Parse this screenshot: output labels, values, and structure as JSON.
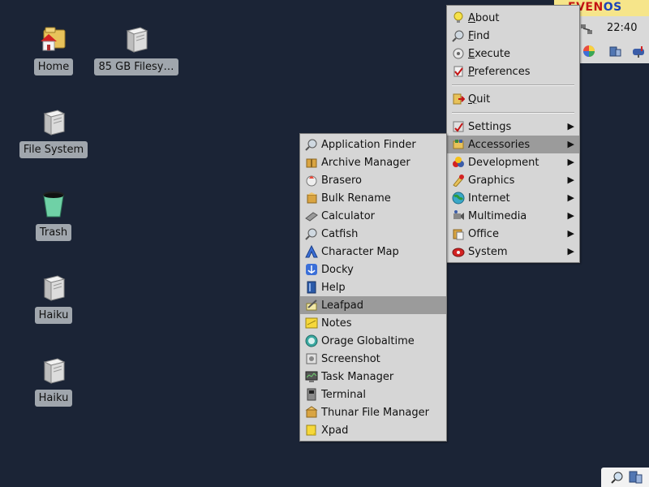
{
  "desktop": {
    "icons": [
      {
        "label": "Home",
        "icon": "home-folder-icon"
      },
      {
        "label": "85 GB Filesy…",
        "icon": "drive-icon"
      },
      {
        "label": "File System",
        "icon": "drive-icon"
      },
      {
        "label": "Trash",
        "icon": "trash-icon"
      },
      {
        "label": "Haiku",
        "icon": "drive-icon"
      },
      {
        "label": "Haiku",
        "icon": "drive-icon"
      }
    ]
  },
  "panel": {
    "brand_part1": "EVEN",
    "brand_part2": "OS",
    "clock": "22:40"
  },
  "main_menu": {
    "items": [
      {
        "label": "About",
        "icon": "lightbulb-icon",
        "underline": "A"
      },
      {
        "label": "Find",
        "icon": "find-icon",
        "underline": "F"
      },
      {
        "label": "Execute",
        "icon": "execute-icon",
        "underline": "E"
      },
      {
        "label": "Preferences",
        "icon": "preferences-icon",
        "underline": "P"
      },
      {
        "label": "Quit",
        "icon": "quit-icon",
        "underline": "Q"
      },
      {
        "label": "Settings",
        "icon": "settings-icon"
      },
      {
        "label": "Accessories",
        "icon": "accessories-icon"
      },
      {
        "label": "Development",
        "icon": "development-icon"
      },
      {
        "label": "Graphics",
        "icon": "graphics-icon"
      },
      {
        "label": "Internet",
        "icon": "internet-icon"
      },
      {
        "label": "Multimedia",
        "icon": "multimedia-icon"
      },
      {
        "label": "Office",
        "icon": "office-icon"
      },
      {
        "label": "System",
        "icon": "system-icon"
      }
    ]
  },
  "accessories_menu": {
    "items": [
      {
        "label": "Application Finder",
        "icon": "app-finder-icon"
      },
      {
        "label": "Archive Manager",
        "icon": "archive-icon"
      },
      {
        "label": "Brasero",
        "icon": "brasero-icon"
      },
      {
        "label": "Bulk Rename",
        "icon": "bulk-rename-icon"
      },
      {
        "label": "Calculator",
        "icon": "calculator-icon"
      },
      {
        "label": "Catfish",
        "icon": "catfish-icon"
      },
      {
        "label": "Character Map",
        "icon": "character-map-icon"
      },
      {
        "label": "Docky",
        "icon": "docky-icon"
      },
      {
        "label": "Help",
        "icon": "help-icon"
      },
      {
        "label": "Leafpad",
        "icon": "leafpad-icon"
      },
      {
        "label": "Notes",
        "icon": "notes-icon"
      },
      {
        "label": "Orage Globaltime",
        "icon": "globaltime-icon"
      },
      {
        "label": "Screenshot",
        "icon": "screenshot-icon"
      },
      {
        "label": "Task Manager",
        "icon": "task-manager-icon"
      },
      {
        "label": "Terminal",
        "icon": "terminal-icon"
      },
      {
        "label": "Thunar File Manager",
        "icon": "thunar-icon"
      },
      {
        "label": "Xpad",
        "icon": "xpad-icon"
      }
    ]
  },
  "colors": {
    "desktop_bg": "#1b2436",
    "menu_bg": "#d6d6d6",
    "menu_active": "#9b9b9b",
    "label_bg": "#a0a6ad",
    "brand_red": "#c41313",
    "brand_blue": "#1a43b8"
  }
}
